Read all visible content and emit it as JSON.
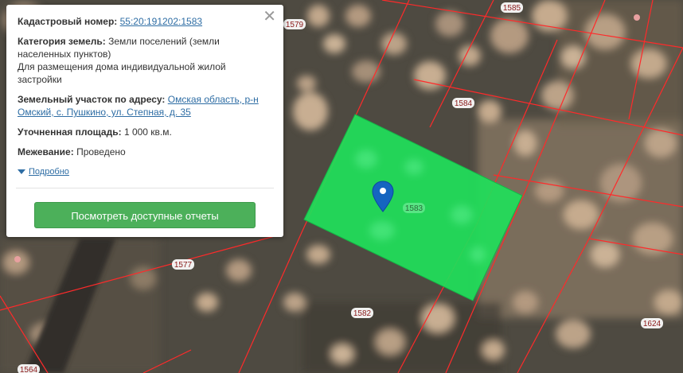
{
  "popup": {
    "cadastral_label": "Кадастровый номер:",
    "cadastral_number": "55:20:191202:1583",
    "category_label": "Категория земель:",
    "category_value_line1": "Земли поселений (земли",
    "category_value_line2": "населенных пунктов)",
    "category_value_line3": "Для размещения дома индивидуальной жилой",
    "category_value_line4": "застройки",
    "address_label": "Земельный участок по адресу:",
    "address_value_line1": "Омская область, р-н",
    "address_value_line2": "Омский, с. Пушкино, ул. Степная, д. 35",
    "area_label": "Уточненная площадь:",
    "area_value": "1 000 кв.м.",
    "survey_label": "Межевание:",
    "survey_value": "Проведено",
    "details_label": "Подробно",
    "reports_button": "Посмотреть доступные отчеты",
    "close_icon": "close-icon"
  },
  "map": {
    "plot_labels": {
      "p1583": "1583",
      "p1585": "1585",
      "p1579": "1579",
      "p1584": "1584",
      "p1577": "1577",
      "p1582": "1582",
      "p1624": "1624",
      "p1564": "1564"
    },
    "colors": {
      "selected_plot": "#1fe05a",
      "boundary": "#ff2a2a",
      "marker": "#1565c0",
      "button": "#4cb05a",
      "link": "#2e6da4"
    }
  }
}
